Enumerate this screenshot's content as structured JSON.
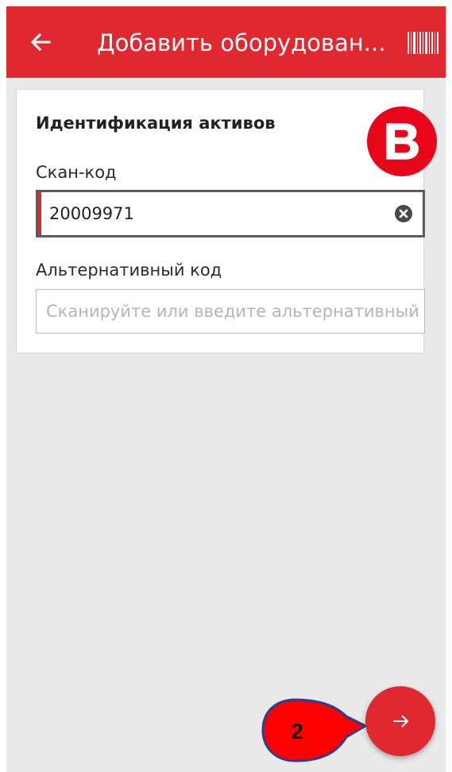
{
  "appbar": {
    "title": "Добавить оборудован...",
    "back_icon": "arrow-left-icon",
    "barcode_icon": "barcode-icon",
    "color": "#e02830"
  },
  "card": {
    "section_title": "Идентификация активов",
    "scan_code": {
      "label": "Скан-код",
      "value": "20009971",
      "clear_icon": "clear-circle-icon"
    },
    "alt_code": {
      "label": "Альтернативный код",
      "value": "",
      "placeholder": "Сканируйте или введите альтернативный код"
    }
  },
  "annotations": {
    "marker_letter": "B",
    "callout_number": "2"
  },
  "fab": {
    "icon": "arrow-right-icon"
  }
}
